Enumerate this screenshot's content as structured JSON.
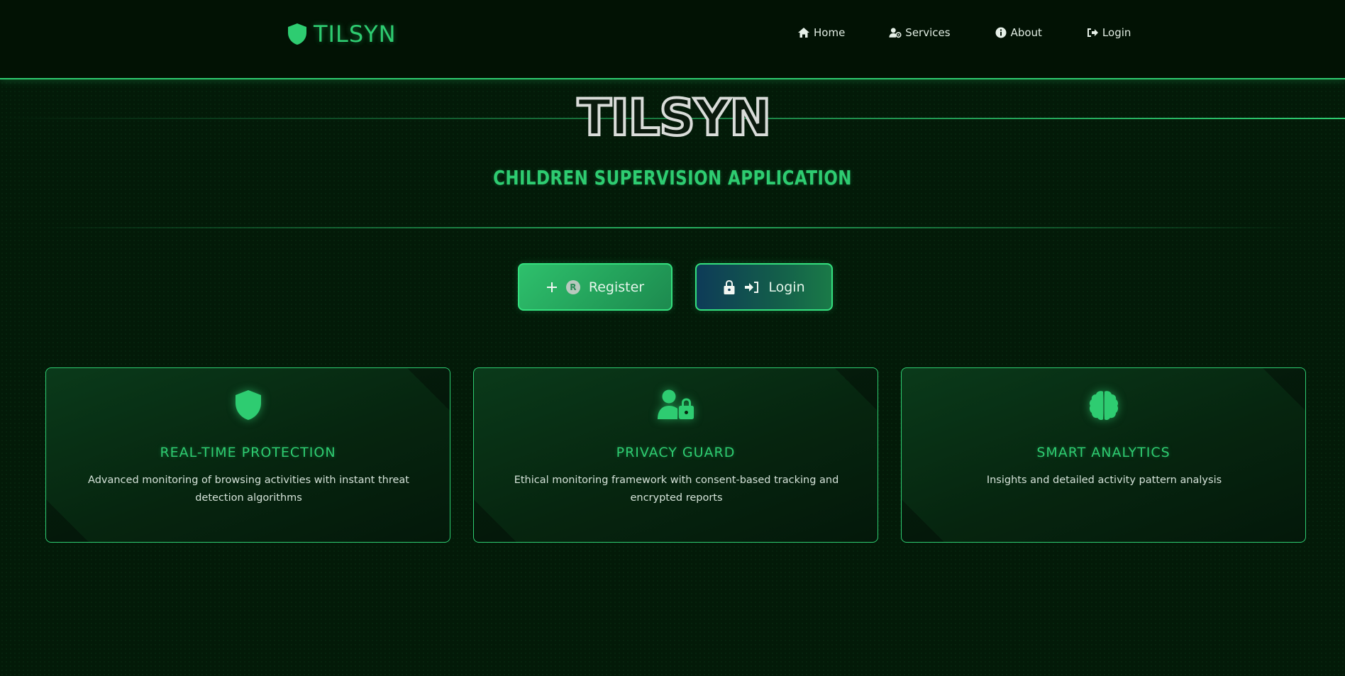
{
  "navbar": {
    "brand": "TILSYN",
    "brand_icon": "shield-icon",
    "links": [
      {
        "label": "Home",
        "icon": "home-icon"
      },
      {
        "label": "Services",
        "icon": "user-gear-icon"
      },
      {
        "label": "About",
        "icon": "info-icon"
      },
      {
        "label": "Login",
        "icon": "sign-in-icon"
      }
    ]
  },
  "hero": {
    "title": "TILSYN",
    "subtitle": "CHILDREN SUPERVISION APPLICATION"
  },
  "buttons": {
    "register": {
      "label": "Register",
      "badge": "R"
    },
    "login": {
      "label": "Login"
    }
  },
  "features": [
    {
      "icon": "shield-icon",
      "title": "REAL-TIME PROTECTION",
      "description": "Advanced monitoring of browsing activities with instant threat detection algorithms"
    },
    {
      "icon": "user-lock-icon",
      "title": "PRIVACY GUARD",
      "description": "Ethical monitoring framework with consent-based tracking and encrypted reports"
    },
    {
      "icon": "brain-icon",
      "title": "SMART ANALYTICS",
      "description": "Insights and detailed activity pattern analysis"
    }
  ],
  "colors": {
    "accent": "#2ecc71",
    "background": "#031a08",
    "navbar": "#021204"
  }
}
